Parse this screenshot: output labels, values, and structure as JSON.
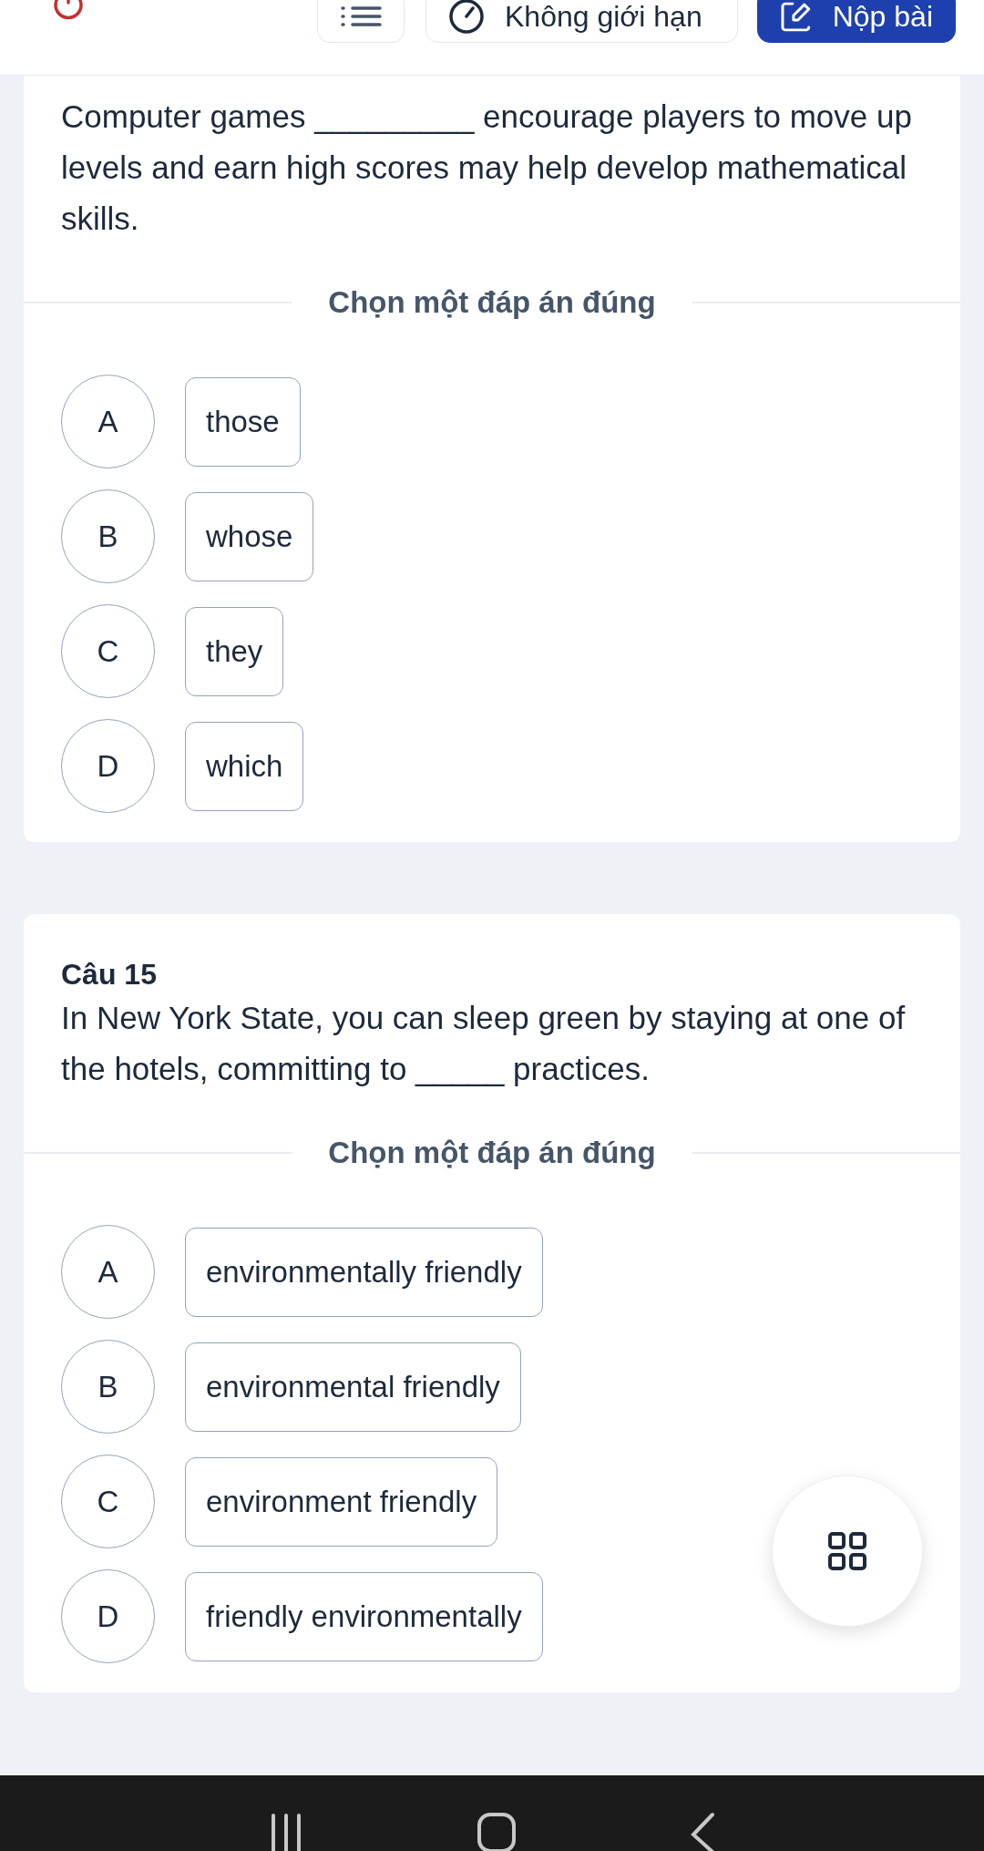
{
  "header": {
    "menu_button": {
      "kind": "menu"
    },
    "timer": {
      "label": "Không giới hạn"
    },
    "submit_button": {
      "label": "Nộp bài"
    }
  },
  "questions": [
    {
      "text": "Computer games _________ encourage players to move up levels and earn high scores may help develop mathematical skills.",
      "prompt": "Chọn một đáp án đúng",
      "options": [
        {
          "letter": "A",
          "text": "those",
          "selected": false
        },
        {
          "letter": "B",
          "text": "whose",
          "selected": false
        },
        {
          "letter": "C",
          "text": "they",
          "selected": false
        },
        {
          "letter": "D",
          "text": "which",
          "selected": false
        }
      ]
    },
    {
      "title": "Câu 15",
      "text": "In New York State, you can sleep green by staying at one of the hotels, committing to _____ practices.",
      "prompt": "Chọn một đáp án đúng",
      "options": [
        {
          "letter": "A",
          "text": "environmentally friendly",
          "selected": false
        },
        {
          "letter": "B",
          "text": "environmental friendly",
          "selected": false
        },
        {
          "letter": "C",
          "text": "environment friendly",
          "selected": false
        },
        {
          "letter": "D",
          "text": "friendly environmentally",
          "selected": false
        }
      ]
    }
  ]
}
